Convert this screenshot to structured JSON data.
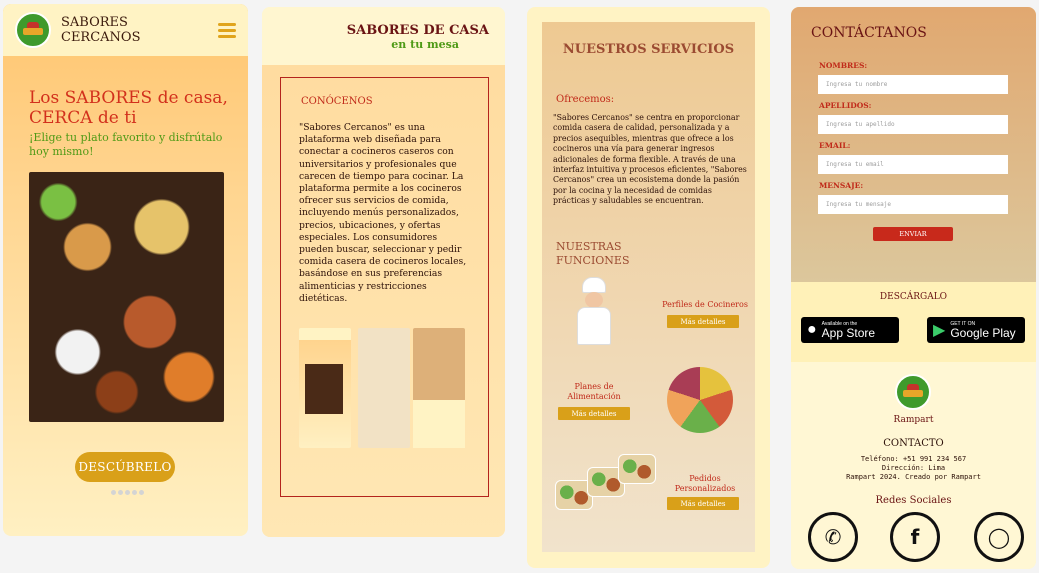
{
  "screen1": {
    "brand_line1": "SABORES",
    "brand_line2": "CERCANOS",
    "hero_title": "Los SABORES de casa, CERCA de ti",
    "hero_subtitle": "¡Elige tu plato favorito y disfrútalo hoy mismo!",
    "cta_label": "DESCÚBRELO"
  },
  "screen2": {
    "title": "SABORES DE CASA",
    "tagline": "en tu mesa",
    "section_title": "CONÓCENOS",
    "about_text": "\"Sabores Cercanos\" es una plataforma web diseñada para conectar a cocineros caseros con universitarios y profesionales que carecen de tiempo para cocinar. La plataforma permite a los cocineros ofrecer sus servicios de comida, incluyendo menús personalizados, precios, ubicaciones, y ofertas especiales. Los consumidores pueden buscar, seleccionar y pedir comida casera de cocineros locales, basándose en sus preferencias alimenticias y restricciones dietéticas."
  },
  "screen3": {
    "services_title": "NUESTROS SERVICIOS",
    "offer_title": "Ofrecemos:",
    "offer_text": "\"Sabores Cercanos\" se centra en proporcionar comida casera de calidad, personalizada y a precios asequibles, mientras que ofrece a los cocineros una vía para generar ingresos adicionales de forma flexible. A través de una interfaz intuitiva y procesos eficientes, \"Sabores Cercanos\" crea un ecosistema donde la pasión por la cocina y la necesidad de comidas prácticas y saludables se encuentran.",
    "functions_title": "NUESTRAS FUNCIONES",
    "features": [
      {
        "title": "Perfiles de Cocineros",
        "button": "Más detalles"
      },
      {
        "title": "Planes de Alimentación",
        "button": "Más detalles"
      },
      {
        "title": "Pedidos Personalizados",
        "button": "Más detalles"
      }
    ]
  },
  "screen4": {
    "contact_title": "CONTÁCTANOS",
    "fields": [
      {
        "label": "NOMBRES:",
        "placeholder": "Ingresa tu nombre"
      },
      {
        "label": "APELLIDOS:",
        "placeholder": "Ingresa tu apellido"
      },
      {
        "label": "EMAIL:",
        "placeholder": "Ingresa tu email"
      },
      {
        "label": "MENSAJE:",
        "placeholder": "Ingresa tu mensaje"
      }
    ],
    "send_label": "ENVIAR",
    "download_title": "DESCÁRGALO",
    "app_store_small": "Available on the",
    "app_store_large": "App Store",
    "google_play_small": "GET IT ON",
    "google_play_large": "Google Play",
    "company": "Rampart",
    "contact_heading": "CONTACTO",
    "phone": "Teléfono: +51 991 234 567",
    "address": "Dirección: Lima",
    "credits": "Rampart 2024. Creado por Rampart",
    "social_title": "Redes Sociales"
  },
  "colors": {
    "accent_gold": "#d9a019",
    "accent_red": "#c02a1a",
    "accent_green": "#4f9a16",
    "brown": "#6a1414"
  },
  "icons": [
    "logo-icon",
    "hamburger-icon",
    "apple-icon",
    "google-play-icon",
    "whatsapp-icon",
    "facebook-icon",
    "instagram-icon"
  ]
}
